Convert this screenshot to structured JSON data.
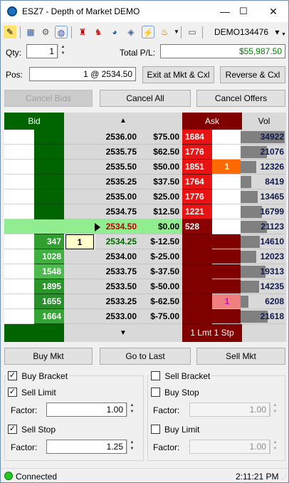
{
  "window": {
    "title": "ESZ7 - Depth of Market DEMO",
    "minimize": "—",
    "maximize": "☐",
    "close": "✕"
  },
  "toolbar": {
    "account": "DEMO134476",
    "account_arrow": "▾"
  },
  "qty": {
    "label": "Qty:",
    "value": "1"
  },
  "total_pl": {
    "label": "Total P/L:",
    "value": "$55,987.50"
  },
  "pos": {
    "label": "Pos:",
    "value": "1 @ 2534.50"
  },
  "buttons": {
    "exit": "Exit at Mkt & Cxl",
    "reverse": "Reverse & Cxl",
    "cancel_bids": "Cancel Bids",
    "cancel_all": "Cancel All",
    "cancel_offers": "Cancel Offers",
    "buy_mkt": "Buy Mkt",
    "go_to_last": "Go to Last",
    "sell_mkt": "Sell Mkt"
  },
  "ladder": {
    "headers": {
      "bid": "Bid",
      "up": "▲",
      "ask": "Ask",
      "vol": "Vol",
      "down": "▼",
      "ask_footer": "1 Lmt 1 Stp"
    },
    "rows": [
      {
        "price": "2536.00",
        "pl": "$75.00",
        "bid": "",
        "ask": "1684",
        "askord": "",
        "vol": "34922",
        "vf": 0.97
      },
      {
        "price": "2535.75",
        "pl": "$62.50",
        "bid": "",
        "ask": "1776",
        "askord": "",
        "vol": "21076",
        "vf": 0.58
      },
      {
        "price": "2535.50",
        "pl": "$50.00",
        "bid": "",
        "ask": "1851",
        "askord": "1",
        "vol": "12326",
        "vf": 0.34
      },
      {
        "price": "2535.25",
        "pl": "$37.50",
        "bid": "",
        "ask": "1764",
        "askord": "",
        "vol": "8419",
        "vf": 0.23
      },
      {
        "price": "2535.00",
        "pl": "$25.00",
        "bid": "",
        "ask": "1776",
        "askord": "",
        "vol": "13465",
        "vf": 0.38
      },
      {
        "price": "2534.75",
        "pl": "$12.50",
        "bid": "",
        "ask": "1221",
        "askord": "",
        "vol": "16799",
        "vf": 0.47
      },
      {
        "price": "2534.50",
        "pl": "$0.00",
        "bid": "",
        "ask": "528",
        "askord": "",
        "vol": "21123",
        "vf": 0.58,
        "current": true
      },
      {
        "price": "2534.25",
        "pl": "$-12.50",
        "bid": "347",
        "bidord": "1",
        "ask": "",
        "askord": "",
        "vol": "14610",
        "vf": 0.42,
        "last": true
      },
      {
        "price": "2534.00",
        "pl": "$-25.00",
        "bid": "1028",
        "ask": "",
        "askord": "",
        "vol": "12023",
        "vf": 0.34
      },
      {
        "price": "2533.75",
        "pl": "$-37.50",
        "bid": "1548",
        "ask": "",
        "askord": "",
        "vol": "19313",
        "vf": 0.55
      },
      {
        "price": "2533.50",
        "pl": "$-50.00",
        "bid": "1895",
        "ask": "",
        "askord": "",
        "vol": "14235",
        "vf": 0.41
      },
      {
        "price": "2533.25",
        "pl": "$-62.50",
        "bid": "1655",
        "ask": "",
        "askord": "1",
        "askpink": true,
        "vol": "6208",
        "vf": 0.17
      },
      {
        "price": "2533.00",
        "pl": "$-75.00",
        "bid": "1664",
        "ask": "",
        "askord": "",
        "vol": "21618",
        "vf": 0.6
      }
    ]
  },
  "bracket_left": {
    "buy_bracket": "Buy Bracket",
    "sell_limit": "Sell Limit",
    "factor1_label": "Factor:",
    "factor1": "1.00",
    "sell_stop": "Sell Stop",
    "factor2_label": "Factor:",
    "factor2": "1.25"
  },
  "bracket_right": {
    "sell_bracket": "Sell Bracket",
    "buy_stop": "Buy Stop",
    "factor1_label": "Factor:",
    "factor1": "1.00",
    "buy_limit": "Buy Limit",
    "factor2_label": "Factor:",
    "factor2": "1.00"
  },
  "status": {
    "text": "Connected",
    "time": "2:11:21 PM"
  },
  "colors": {
    "accent": "#1e73be",
    "bid_green": "#006400",
    "ask_red": "#800000"
  }
}
